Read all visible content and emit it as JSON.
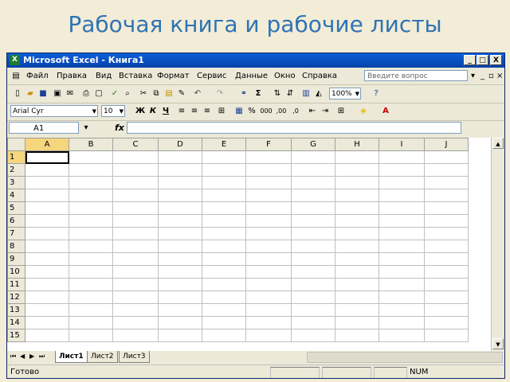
{
  "slide_title": "Рабочая книга и рабочие листы",
  "window": {
    "title": "Microsoft Excel - Книга1",
    "app_icon": "X",
    "min": "_",
    "max": "□",
    "close": "X"
  },
  "menu": {
    "items": [
      "Файл",
      "Правка",
      "Вид",
      "Вставка",
      "Формат",
      "Сервис",
      "Данные",
      "Окно",
      "Справка"
    ],
    "help_placeholder": "Введите вопрос",
    "mdi_min": "_",
    "mdi_restore": "▫",
    "mdi_close": "×"
  },
  "standard_toolbar": {
    "zoom": "100%"
  },
  "formatting_toolbar": {
    "font": "Arial Cyr",
    "size": "10",
    "bold": "Ж",
    "italic": "К",
    "underline": "Ч",
    "percent": "%",
    "thousands": "000",
    "inc_dec": ",00",
    "dec_dec": ",0"
  },
  "formula_bar": {
    "name_box": "A1",
    "fx": "fx",
    "value": ""
  },
  "grid": {
    "columns": [
      "A",
      "B",
      "C",
      "D",
      "E",
      "F",
      "G",
      "H",
      "I",
      "J"
    ],
    "rows": [
      "1",
      "2",
      "3",
      "4",
      "5",
      "6",
      "7",
      "8",
      "9",
      "10",
      "11",
      "12",
      "13",
      "14",
      "15"
    ],
    "active_cell": "A1"
  },
  "sheets": {
    "tabs": [
      "Лист1",
      "Лист2",
      "Лист3"
    ],
    "active": "Лист1"
  },
  "status": {
    "ready": "Готово",
    "num": "NUM"
  },
  "colors": {
    "title_blue": "#2e74b5",
    "xp_titlebar": "#0a5fd8",
    "chrome": "#ece9d8"
  }
}
